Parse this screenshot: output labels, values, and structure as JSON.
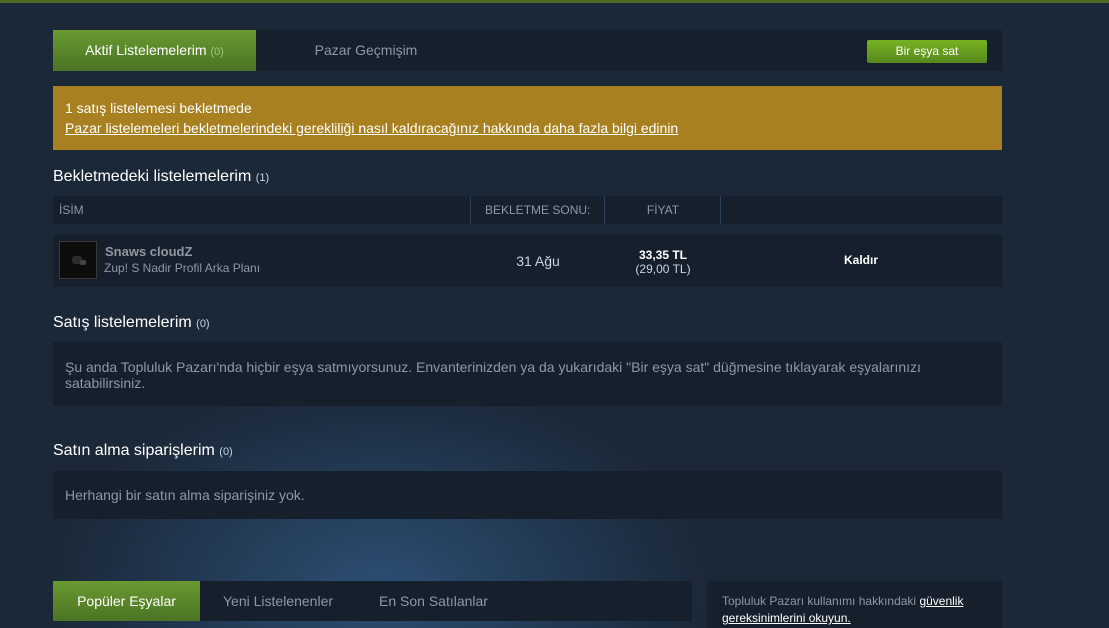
{
  "tabs": {
    "active_label": "Aktif Listelemelerim",
    "active_count": "(0)",
    "history_label": "Pazar Geçmişim",
    "sell_button": "Bir eşya sat"
  },
  "alert": {
    "line1": "1 satış listelemesi bekletmede",
    "link": "Pazar listelemeleri bekletmelerindeki gerekliliği nasıl kaldıracağınız hakkında daha fazla bilgi edinin"
  },
  "held": {
    "title": "Bekletmedeki listelemelerim",
    "count": "(1)",
    "columns": {
      "name": "İSİM",
      "hold_end": "BEKLETME SONU:",
      "price": "FİYAT"
    },
    "row": {
      "item_name": "Snaws cloudZ",
      "item_game": "Zup! S Nadir Profil Arka Planı",
      "hold_end": "31 Ağu",
      "price": "33,35 TL",
      "price_net": "(29,00 TL)",
      "remove": "Kaldır"
    }
  },
  "sell": {
    "title": "Satış listelemelerim",
    "count": "(0)",
    "text_line1": "Şu anda Topluluk Pazarı'nda hiçbir eşya satmıyorsunuz. Envanterinizden ya da yukarıdaki \"Bir eşya sat\" düğmesine tıklayarak eşyalarınızı",
    "text_line2": "satabilirsiniz."
  },
  "buy": {
    "title": "Satın alma siparişlerim",
    "count": "(0)",
    "text": "Herhangi bir satın alma siparişiniz yok."
  },
  "bottom_tabs": {
    "popular": "Popüler Eşyalar",
    "new": "Yeni Listelenenler",
    "recent": "En Son Satılanlar"
  },
  "side": {
    "text": "Topluluk Pazarı kullanımı hakkındaki ",
    "link1": "güvenlik",
    "link2": "gereksinimlerini okuyun."
  },
  "colors": {
    "accent_green": "#75b022",
    "alert_bg": "#a8801f",
    "page_bg": "#1b2838"
  }
}
